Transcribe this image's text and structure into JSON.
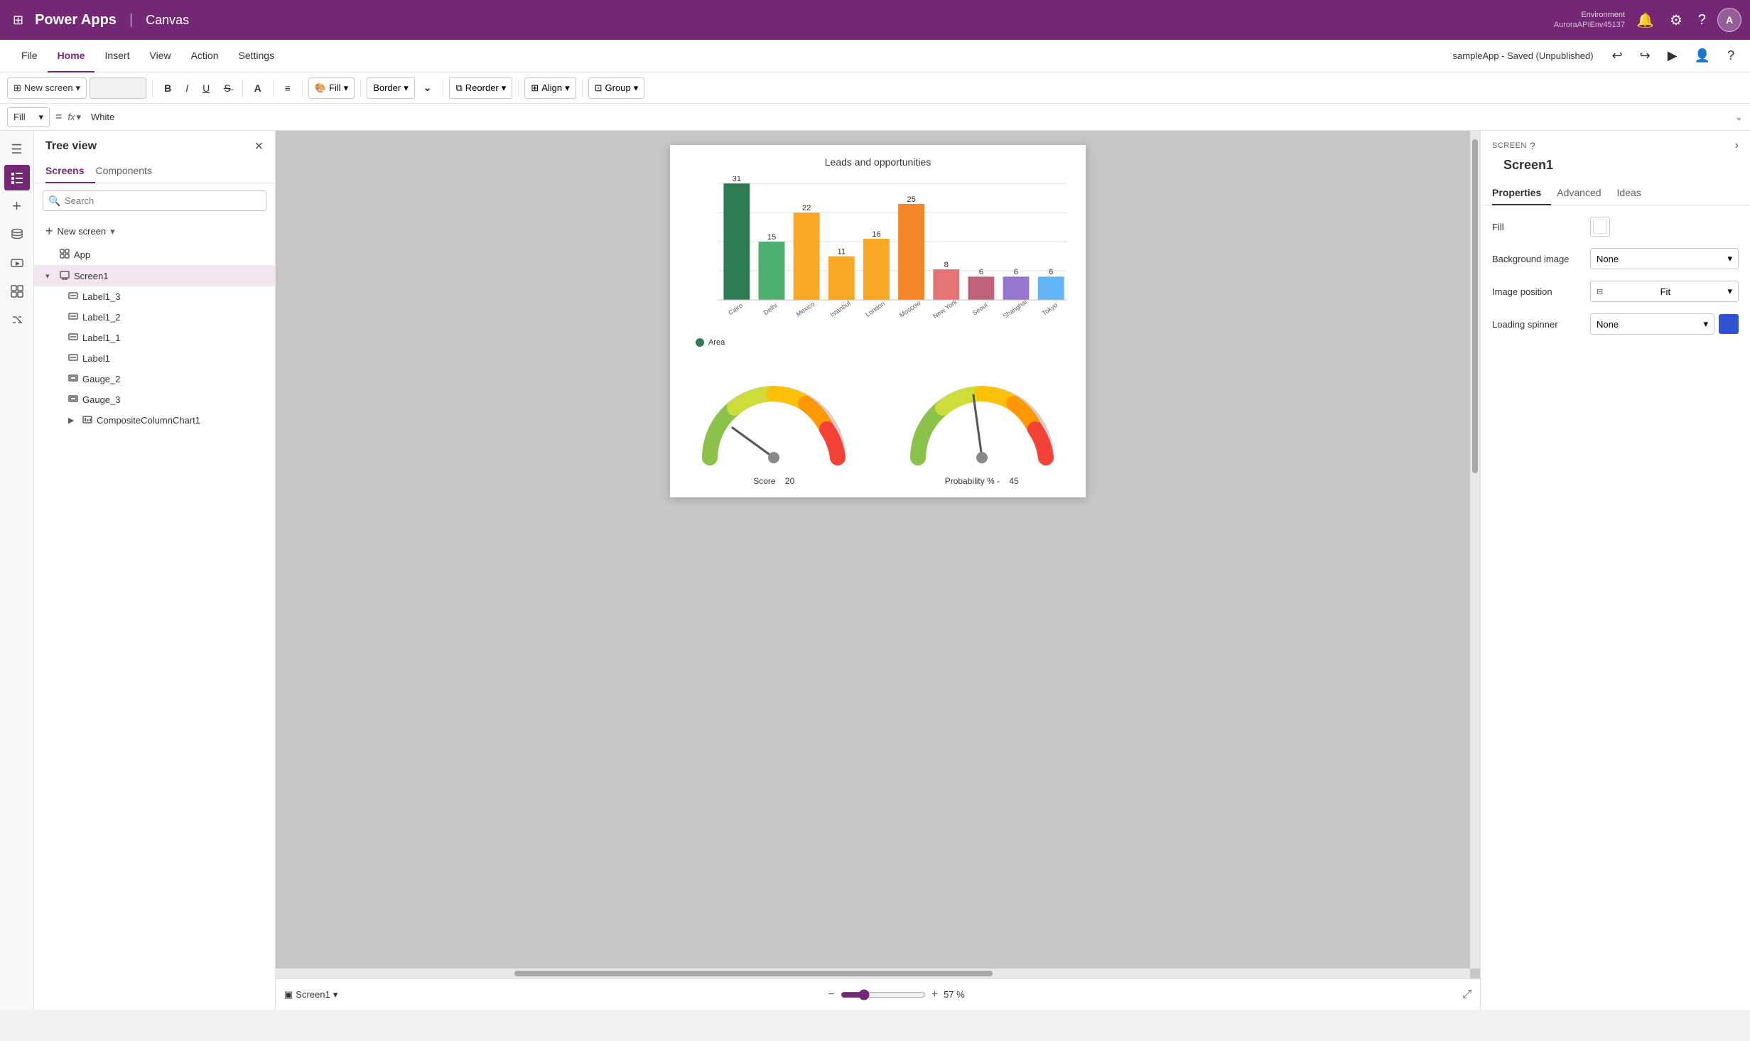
{
  "topbar": {
    "grid_icon": "⊞",
    "app_name": "Power Apps",
    "divider": "|",
    "canvas_label": "Canvas",
    "environment_label": "Environment",
    "environment_value": "AuroraAPIEnv45137",
    "avatar_label": "A",
    "bell_icon": "🔔",
    "gear_icon": "⚙",
    "help_icon": "?"
  },
  "menubar": {
    "items": [
      "File",
      "Home",
      "Insert",
      "View",
      "Action",
      "Settings"
    ],
    "active_item": "Home",
    "app_status": "sampleApp - Saved (Unpublished)"
  },
  "toolbar": {
    "new_screen_label": "New screen",
    "fill_label": "Fill",
    "border_label": "Border",
    "reorder_label": "Reorder",
    "align_label": "Align",
    "group_label": "Group"
  },
  "formulabar": {
    "fill_label": "Fill",
    "equals": "=",
    "fx_label": "fx",
    "formula_value": "White"
  },
  "tree_view": {
    "title": "Tree view",
    "tabs": [
      "Screens",
      "Components"
    ],
    "active_tab": "Screens",
    "search_placeholder": "Search",
    "new_screen_label": "New screen",
    "items": [
      {
        "label": "App",
        "icon": "app",
        "level": 0,
        "expanded": false
      },
      {
        "label": "Screen1",
        "icon": "screen",
        "level": 0,
        "expanded": true,
        "selected": true,
        "has_more": true
      },
      {
        "label": "Label1_3",
        "icon": "label",
        "level": 1
      },
      {
        "label": "Label1_2",
        "icon": "label",
        "level": 1
      },
      {
        "label": "Label1_1",
        "icon": "label",
        "level": 1
      },
      {
        "label": "Label1",
        "icon": "label",
        "level": 1
      },
      {
        "label": "Gauge_2",
        "icon": "gauge",
        "level": 1
      },
      {
        "label": "Gauge_3",
        "icon": "gauge",
        "level": 1
      },
      {
        "label": "CompositeColumnChart1",
        "icon": "chart",
        "level": 1,
        "has_expand": true
      }
    ]
  },
  "canvas": {
    "chart": {
      "title": "Leads and opportunities",
      "bars": [
        {
          "city": "Cairo",
          "value": 31,
          "color": "#2e7d52"
        },
        {
          "city": "Delhi",
          "value": 15,
          "color": "#4caf72"
        },
        {
          "city": "Mexico",
          "value": 22,
          "color": "#f9a825"
        },
        {
          "city": "Istanbul",
          "value": 11,
          "color": "#f9a825"
        },
        {
          "city": "London",
          "value": 16,
          "color": "#f9a825"
        },
        {
          "city": "Moscow",
          "value": 25,
          "color": "#f4862a"
        },
        {
          "city": "New York",
          "value": 8,
          "color": "#e57373"
        },
        {
          "city": "Seoul",
          "value": 6,
          "color": "#c0627a"
        },
        {
          "city": "Shanghai",
          "value": 6,
          "color": "#9575cd"
        },
        {
          "city": "Tokyo",
          "value": 6,
          "color": "#64b5f6"
        }
      ],
      "legend_label": "Area"
    },
    "gauges": [
      {
        "label": "Score",
        "value": "20",
        "needle_angle": -60
      },
      {
        "label": "Probability % -",
        "value": "45",
        "needle_angle": -20
      }
    ]
  },
  "bottom_bar": {
    "screen_label": "Screen1",
    "zoom_value": "57",
    "zoom_unit": "%"
  },
  "properties": {
    "screen_label": "SCREEN",
    "screen_name": "Screen1",
    "tabs": [
      "Properties",
      "Advanced",
      "Ideas"
    ],
    "active_tab": "Properties",
    "fill_label": "Fill",
    "background_image_label": "Background image",
    "background_image_value": "None",
    "image_position_label": "Image position",
    "image_position_value": "Fit",
    "loading_spinner_label": "Loading spinner",
    "loading_spinner_value": "None",
    "loading_spinner_color": "#3052d0"
  }
}
